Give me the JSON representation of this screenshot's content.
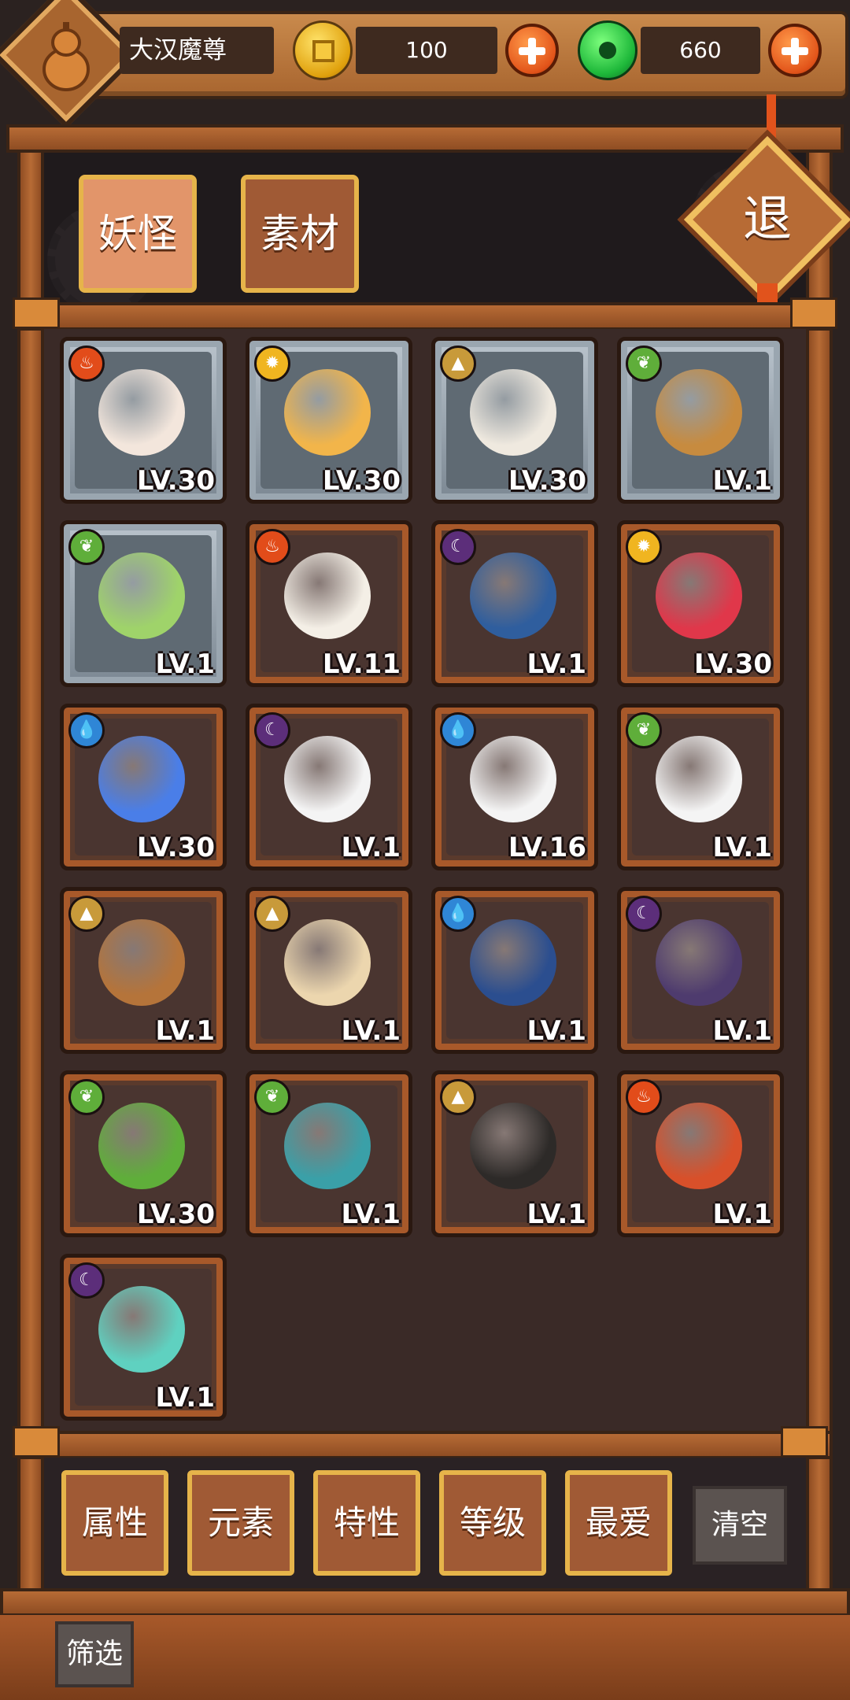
{
  "player": {
    "name": "大汉魔尊"
  },
  "currency": {
    "coins": "100",
    "jade": "660"
  },
  "tabs": [
    {
      "label": "妖怪",
      "active": true
    },
    {
      "label": "素材",
      "active": false
    }
  ],
  "exit_label": "退",
  "monsters": [
    {
      "element": "fire",
      "level": "LV.30",
      "frame": "silver",
      "color": "#f3e6dc"
    },
    {
      "element": "gold",
      "level": "LV.30",
      "frame": "silver",
      "color": "#f2b54a"
    },
    {
      "element": "earth",
      "level": "LV.30",
      "frame": "silver",
      "color": "#efe9df"
    },
    {
      "element": "wood",
      "level": "LV.1",
      "frame": "silver",
      "color": "#c78b3f"
    },
    {
      "element": "wood",
      "level": "LV.1",
      "frame": "silver",
      "color": "#9fd36a"
    },
    {
      "element": "fire",
      "level": "LV.11",
      "frame": "bronze",
      "color": "#f4efe6"
    },
    {
      "element": "moon",
      "level": "LV.1",
      "frame": "bronze",
      "color": "#2f5e9e"
    },
    {
      "element": "gold",
      "level": "LV.30",
      "frame": "bronze",
      "color": "#e0374a"
    },
    {
      "element": "water",
      "level": "LV.30",
      "frame": "bronze",
      "color": "#4a7ee8"
    },
    {
      "element": "moon",
      "level": "LV.1",
      "frame": "bronze",
      "color": "#f4f4f4"
    },
    {
      "element": "water",
      "level": "LV.16",
      "frame": "bronze",
      "color": "#f4f4f4"
    },
    {
      "element": "wood",
      "level": "LV.1",
      "frame": "bronze",
      "color": "#f4f4f4"
    },
    {
      "element": "earth",
      "level": "LV.1",
      "frame": "bronze",
      "color": "#b5743a"
    },
    {
      "element": "earth",
      "level": "LV.1",
      "frame": "bronze",
      "color": "#ecd6ae"
    },
    {
      "element": "water",
      "level": "LV.1",
      "frame": "bronze",
      "color": "#2b4e8f"
    },
    {
      "element": "moon",
      "level": "LV.1",
      "frame": "bronze",
      "color": "#4e3b6e"
    },
    {
      "element": "wood",
      "level": "LV.30",
      "frame": "bronze",
      "color": "#5fae3a"
    },
    {
      "element": "wood",
      "level": "LV.1",
      "frame": "bronze",
      "color": "#3aa0a8"
    },
    {
      "element": "earth",
      "level": "LV.1",
      "frame": "bronze",
      "color": "#2d2a28"
    },
    {
      "element": "fire",
      "level": "LV.1",
      "frame": "bronze",
      "color": "#d8502a"
    },
    {
      "element": "moon",
      "level": "LV.1",
      "frame": "bronze",
      "color": "#5fd1c0"
    }
  ],
  "filters": [
    {
      "label": "属性"
    },
    {
      "label": "元素"
    },
    {
      "label": "特性"
    },
    {
      "label": "等级"
    },
    {
      "label": "最爱"
    }
  ],
  "clear_label": "清空",
  "filter_label": "筛选",
  "colors": {
    "wood": "#a8652f",
    "panel_dark": "#3a2a27",
    "tab_active": "#e2956a",
    "tab_border": "#e6b44a"
  }
}
